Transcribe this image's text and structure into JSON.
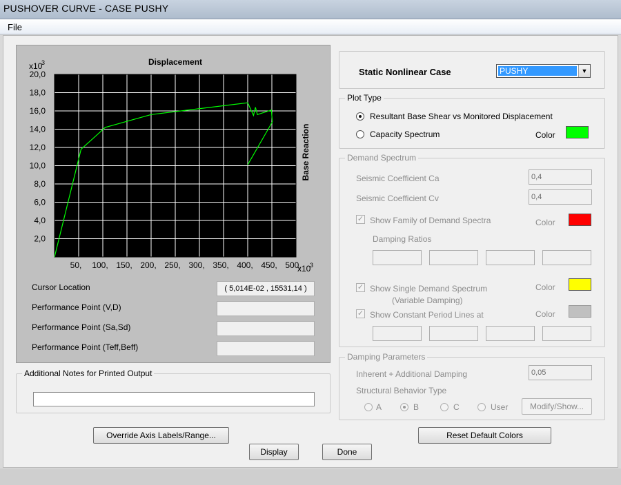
{
  "window": {
    "title": "PUSHOVER CURVE - CASE PUSHY"
  },
  "menu": {
    "file": "File"
  },
  "plot": {
    "title": "Displacement",
    "ylabel": "Base Reaction",
    "x_multiplier": "x10",
    "x_exp": "3",
    "y_multiplier": "x10",
    "y_exp": "3",
    "bg_color": "#000000",
    "grid_color": "#ffffff",
    "curve_color": "#00ff00"
  },
  "chart_data": {
    "type": "line",
    "title": "Displacement",
    "xlabel": "",
    "ylabel": "Base Reaction",
    "x_ticks": [
      "50,",
      "100,",
      "150,",
      "200,",
      "250,",
      "300,",
      "350,",
      "400,",
      "450,",
      "500,"
    ],
    "y_ticks": [
      "2,0",
      "4,0",
      "6,0",
      "8,0",
      "10,0",
      "12,0",
      "14,0",
      "16,0",
      "18,0",
      "20,0"
    ],
    "xlim": [
      0,
      500
    ],
    "ylim": [
      0,
      20
    ],
    "grid": true,
    "series": [
      {
        "color": "#00ff00",
        "x": [
          0,
          55,
          80,
          105,
          200,
          400,
          412,
          416,
          420,
          449,
          451,
          400
        ],
        "y": [
          0,
          11.8,
          13.0,
          14.2,
          15.6,
          16.9,
          15.5,
          16.4,
          15.6,
          16.1,
          14.8,
          10.1
        ]
      }
    ]
  },
  "readouts": {
    "cursor_label": "Cursor Location",
    "cursor_value": "( 5,014E-02 , 15531,14 )",
    "perf_vd_label": "Performance Point (V,D)",
    "perf_sasd_label": "Performance Point (Sa,Sd)",
    "perf_teff_label": "Performance Point (Teff,Beff)",
    "perf_vd_value": "",
    "perf_sasd_value": "",
    "perf_teff_value": ""
  },
  "notes": {
    "label": "Additional Notes for Printed Output",
    "value": ""
  },
  "case": {
    "label": "Static Nonlinear Case",
    "selected": "PUSHY"
  },
  "plot_type": {
    "legend": "Plot Type",
    "option1": "Resultant Base Shear vs Monitored Displacement",
    "option2": "Capacity Spectrum",
    "selected": "option1",
    "color_label": "Color",
    "color": "#00ff00"
  },
  "demand": {
    "legend": "Demand Spectrum",
    "ca_label": "Seismic Coefficient  Ca",
    "ca_value": "0,4",
    "cv_label": "Seismic Coefficient  Cv",
    "cv_value": "0,4",
    "family_label": "Show Family of Demand Spectra",
    "family_color": "#ff0000",
    "damping_label": "Damping Ratios",
    "damping_values": [
      "",
      "",
      "",
      ""
    ],
    "single_label": "Show Single  Demand Spectrum",
    "single_sub": "(Variable Damping)",
    "single_color": "#ffff00",
    "const_label": "Show Constant Period Lines at",
    "const_color": "#c0c0c0",
    "const_values": [
      "",
      "",
      "",
      ""
    ],
    "color_label": "Color"
  },
  "damping_params": {
    "legend": "Damping Parameters",
    "inherent_label": "Inherent + Additional Damping",
    "inherent_value": "0,05",
    "behavior_label": "Structural Behavior Type",
    "options": [
      "A",
      "B",
      "C",
      "User"
    ],
    "selected": "B",
    "modify_label": "Modify/Show..."
  },
  "buttons": {
    "override": "Override Axis Labels/Range...",
    "reset": "Reset Default Colors",
    "display": "Display",
    "done": "Done"
  }
}
